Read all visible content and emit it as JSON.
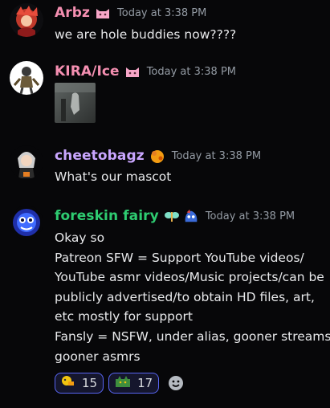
{
  "colors": {
    "background": "#070709",
    "arbz": "#f48fb1",
    "kira": "#f48fb1",
    "cheetobagz": "#c9a6ff",
    "foreskin_fairy": "#2ecc71",
    "timestamp": "#949ba4",
    "reaction_border": "#5865f2"
  },
  "messages": [
    {
      "username": "Arbz",
      "badge_icon": "pink-cat-icon",
      "timestamp": "Today at 3:38 PM",
      "lines": [
        "we are hole buddies now????"
      ],
      "avatar_icon": "red-character-avatar"
    },
    {
      "username": "KIRA/Ice",
      "badge_icon": "pink-cat-icon",
      "timestamp": "Today at 3:38 PM",
      "attachment": "image-attachment-thumbnail",
      "avatar_icon": "skeleton-character-avatar"
    },
    {
      "username": "cheetobagz",
      "badge_icon": "cheeto-icon",
      "timestamp": "Today at 3:38 PM",
      "lines": [
        "What's our mascot"
      ],
      "avatar_icon": "anime-character-avatar"
    },
    {
      "username": "foreskin fairy",
      "badge_icons": [
        "fairy-icon",
        "blue-blob-icon"
      ],
      "timestamp": "Today at 3:38 PM",
      "avatar_icon": "blue-creature-avatar",
      "lines": [
        "Okay so",
        "Patreon SFW = Support YouTube videos/",
        "YouTube asmr videos/Music projects/can be",
        "publicly advertised/to obtain HD files, art,",
        "etc mostly for support",
        "Fansly = NSFW, under alias, gooner streams,",
        "gooner asmrs"
      ]
    }
  ],
  "reactions": [
    {
      "icon": "yellow-emoji-icon",
      "count": "15"
    },
    {
      "icon": "green-cat-emoji-icon",
      "count": "17"
    }
  ]
}
